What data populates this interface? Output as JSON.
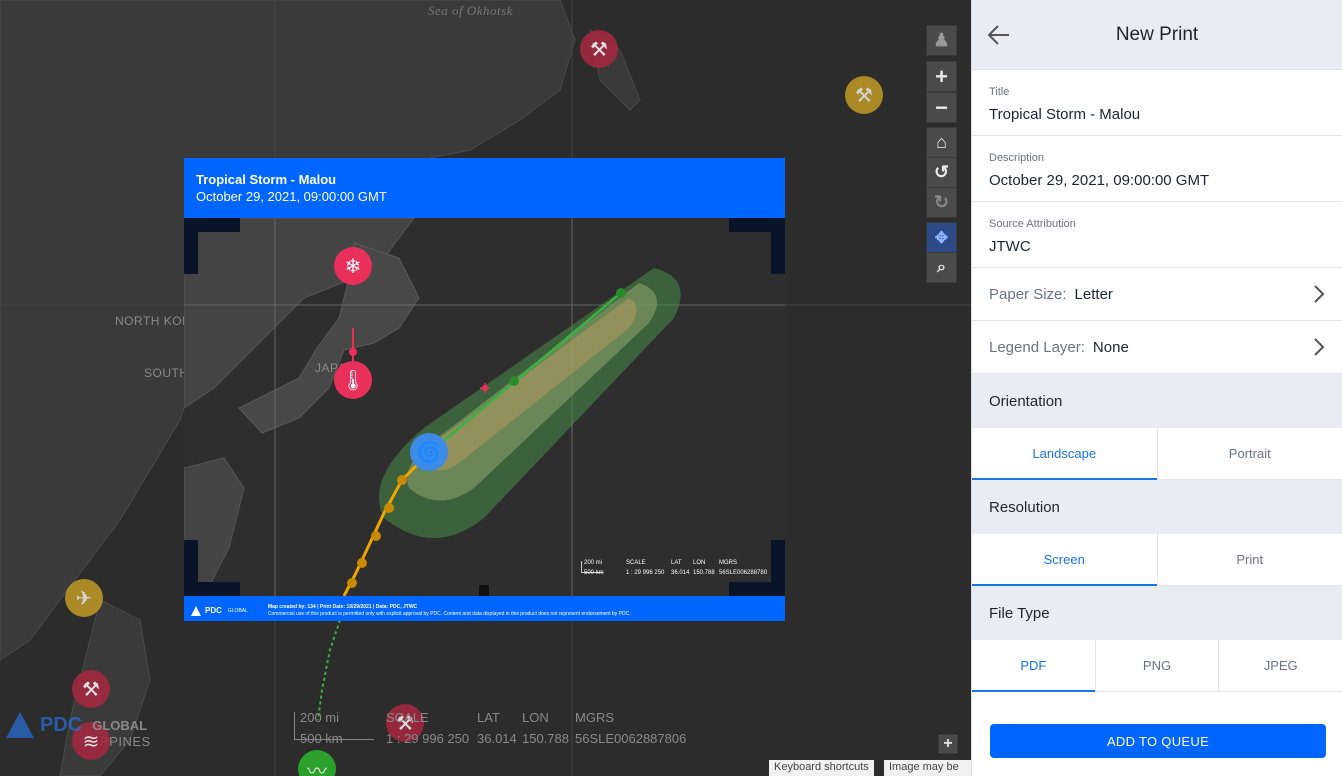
{
  "map": {
    "labels": {
      "sea": "Sea of Okhotsk",
      "north_korea": "NORTH KOREA",
      "south_korea": "SOUTH KOREA",
      "japan": "JAPAN",
      "philippines": "PPINES"
    },
    "scale": {
      "mi": "200 mi",
      "km": "500 km",
      "scale_label": "SCALE",
      "scale_value": "1 : 29 996 250",
      "lat_label": "LAT",
      "lat_value": "36.014",
      "lon_label": "LON",
      "lon_value": "150.788",
      "mgrs_label": "MGRS",
      "mgrs_value": "56SLE0062887806"
    },
    "logo": {
      "pdc": "PDC",
      "global": "GLOBAL"
    },
    "attribution": {
      "shortcuts": "Keyboard shortcuts",
      "image": "Image may be s"
    }
  },
  "frame": {
    "title": "Tropical Storm - Malou",
    "date": "October 29, 2021, 09:00:00 GMT",
    "footer_logo": "PDC",
    "footer_global": "GLOBAL",
    "footer_line1": "Map created by: 134 | Print Date: 10/29/2021 | Data: PDC, JTWC",
    "footer_line2": "Commercial use of this product is permitted only with explicit approval by PDC. Content and data displayed in this product does not represent endorsement by PDC.",
    "scale": {
      "mi": "200 mi",
      "km": "500 km",
      "scale_label": "SCALE",
      "scale_value": "1 : 29 996 250",
      "lat_label": "LAT",
      "lat_value": "36.014",
      "lon_label": "LON",
      "lon_value": "150.788",
      "mgrs_label": "MGRS",
      "mgrs_value": "56SLE006288780"
    }
  },
  "panel": {
    "title": "New Print",
    "title_field": {
      "label": "Title",
      "value": "Tropical Storm - Malou"
    },
    "description_field": {
      "label": "Description",
      "value": "October 29, 2021, 09:00:00 GMT"
    },
    "source_field": {
      "label": "Source Attribution",
      "value": "JTWC"
    },
    "paper_size": {
      "label": "Paper Size:",
      "value": "Letter"
    },
    "legend_layer": {
      "label": "Legend Layer:",
      "value": "None"
    },
    "orientation": {
      "heading": "Orientation",
      "options": [
        "Landscape",
        "Portrait"
      ],
      "selected": "Landscape"
    },
    "resolution": {
      "heading": "Resolution",
      "options": [
        "Screen",
        "Print"
      ],
      "selected": "Screen"
    },
    "file_type": {
      "heading": "File Type",
      "options": [
        "PDF",
        "PNG",
        "JPEG"
      ],
      "selected": "PDF"
    },
    "add_button": "ADD TO QUEUE"
  },
  "colors": {
    "accent": "#0066ff",
    "selected_tab": "#1a73e8",
    "panel_header_bg": "#e9edf3",
    "storm_track_past": "#f0a500",
    "storm_track_forecast": "#3cb043",
    "hazard_red": "#e8305a",
    "hazard_green": "#2bb52b",
    "hazard_yellow": "#c9a227"
  }
}
